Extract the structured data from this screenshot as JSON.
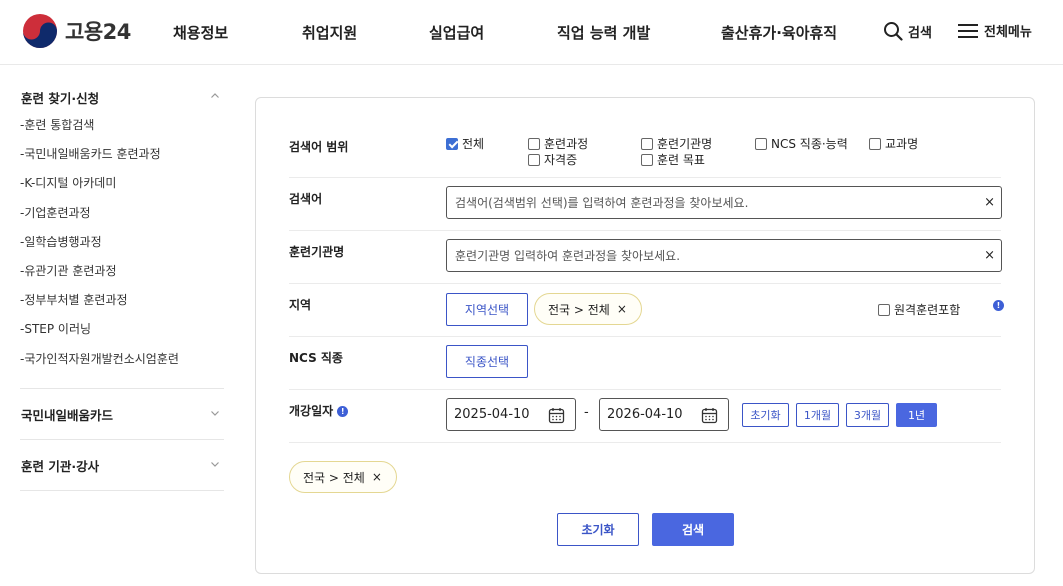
{
  "header": {
    "logo_text": "고용24",
    "nav": [
      "채용정보",
      "취업지원",
      "실업급여",
      "직업 능력 개발",
      "출산휴가·육아휴직"
    ],
    "search_label": "검색",
    "menu_label": "전체메뉴"
  },
  "sidebar": {
    "section1": {
      "title": "훈련 찾기·신청",
      "items": [
        "훈련 통합검색",
        "국민내일배움카드 훈련과정",
        "K-디지털 아카데미",
        "기업훈련과정",
        "일학습병행과정",
        "유관기관 훈련과정",
        "정부부처별 훈련과정",
        "STEP 이러닝",
        "국가인적자원개발컨소시엄훈련"
      ]
    },
    "section2": {
      "title": "국민내일배움카드"
    },
    "section3": {
      "title": "훈련 기관·강사"
    }
  },
  "form": {
    "scope": {
      "label": "검색어 범위",
      "options": [
        {
          "label": "전체",
          "checked": true
        },
        {
          "label": "훈련과정",
          "checked": false
        },
        {
          "label": "훈련기관명",
          "checked": false
        },
        {
          "label": "NCS 직종·능력",
          "checked": false
        },
        {
          "label": "교과명",
          "checked": false
        },
        {
          "label": "자격증",
          "checked": false
        },
        {
          "label": "훈련 목표",
          "checked": false
        }
      ]
    },
    "keyword": {
      "label": "검색어",
      "value": "",
      "placeholder": "검색어(검색범위 선택)를 입력하여 훈련과정을 찾아보세요.",
      "clear": "×"
    },
    "institution": {
      "label": "훈련기관명",
      "value": "",
      "placeholder": "훈련기관명 입력하여 훈련과정을 찾아보세요.",
      "clear": "×"
    },
    "region": {
      "label": "지역",
      "select_button": "지역선택",
      "chip": "전국 > 전체",
      "chip_remove": "×",
      "remote_label": "원격훈련포함",
      "remote_checked": false,
      "info": "!"
    },
    "ncs": {
      "label": "NCS 직종",
      "select_button": "직종선택"
    },
    "date": {
      "label": "개강일자",
      "info": "!",
      "start": "2025-04-10",
      "separator": "-",
      "end": "2026-04-10",
      "reset": "초기화",
      "m1": "1개월",
      "m3": "3개월",
      "y1": "1년",
      "active_period": "1년"
    },
    "selected_chip": "전국 > 전체",
    "selected_chip_remove": "×",
    "reset_button": "초기화",
    "search_button": "검색",
    "accent_color": "#4a67e0"
  }
}
